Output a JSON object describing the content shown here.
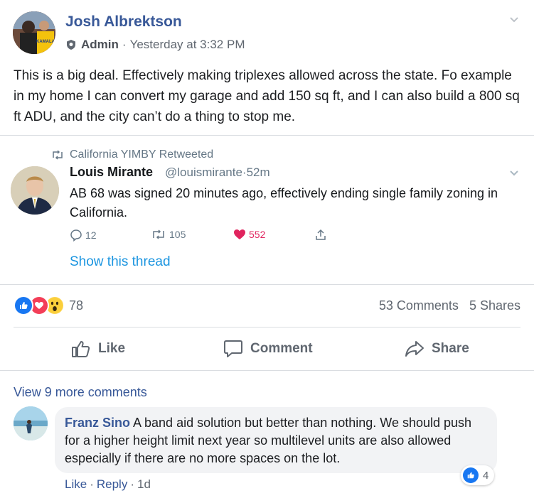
{
  "post": {
    "author": "Josh Albrektson",
    "role": "Admin",
    "separator": "·",
    "timestamp": "Yesterday at 3:32 PM",
    "text": "This is a big deal. Effectively making triplexes allowed across the state. Fo example in my home I can convert my garage and add 150 sq ft, and I can also build a 800 sq ft ADU, and the city can’t do a thing to stop me.",
    "avatar_sign_text": "KAMALA"
  },
  "tweet": {
    "retweeted_by": "California YIMBY Retweeted",
    "author_name": "Louis Mirante",
    "handle": "@louismirante",
    "separator": "·",
    "age": "52m",
    "text": "AB 68 was signed 20 minutes ago, effectively ending single family zoning in California.",
    "replies": "12",
    "retweets": "105",
    "likes": "552",
    "show_thread": "Show this thread"
  },
  "summary": {
    "reaction_icons": [
      "like-reaction-icon",
      "love-reaction-icon",
      "wow-reaction-icon"
    ],
    "reaction_count": "78",
    "comments": "53 Comments",
    "shares": "5 Shares"
  },
  "actions": {
    "like": "Like",
    "comment": "Comment",
    "share": "Share"
  },
  "comments": {
    "view_more": "View 9 more comments",
    "items": [
      {
        "author": "Franz Sino",
        "text": "A band aid solution but better than nothing. We should push for a higher height limit next year so multilevel units are also allowed especially if there are no more spaces on the lot.",
        "reaction_count": "4",
        "like_link": "Like",
        "reply_link": "Reply",
        "separator": "·",
        "time": "1d"
      }
    ]
  },
  "colors": {
    "facebook_blue": "#385898",
    "twitter_blue": "#1b95e0",
    "like_red": "#e0245e",
    "muted": "#606770"
  }
}
